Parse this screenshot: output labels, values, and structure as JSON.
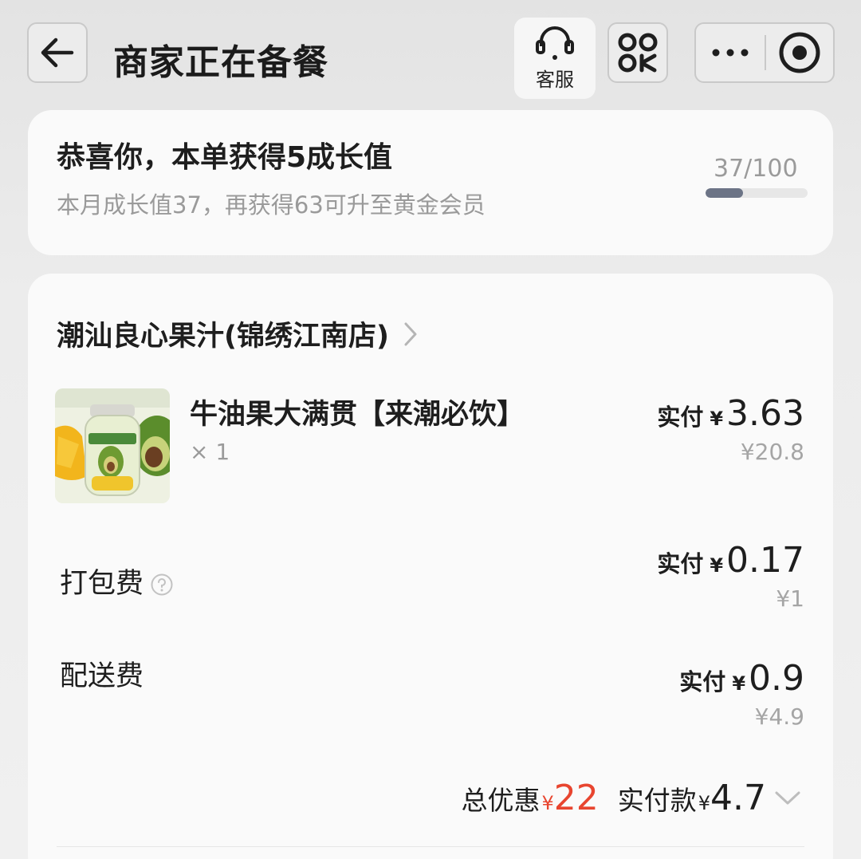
{
  "header": {
    "title": "商家正在备餐",
    "customer_service_label": "客服"
  },
  "growth": {
    "title": "恭喜你，本单获得5成长值",
    "subtitle": "本月成长值37，再获得63可升至黄金会员",
    "progress_text": "37/100",
    "progress_fraction": 0.37
  },
  "order": {
    "shop_name": "潮汕良心果汁(锦绣江南店)",
    "product": {
      "name": "牛油果大满贯【来潮必饮】",
      "qty": "× 1",
      "paid_label": "实付",
      "yen": "¥",
      "paid_amount": "3.63",
      "original_price": "¥20.8"
    },
    "packing_fee": {
      "label": "打包费",
      "paid_label": "实付",
      "yen": "¥",
      "paid_amount": "0.17",
      "original_price": "¥1"
    },
    "delivery_fee": {
      "label": "配送费",
      "paid_label": "实付",
      "yen": "¥",
      "paid_amount": "0.9",
      "original_price": "¥4.9"
    },
    "total": {
      "discount_label": "总优惠",
      "yen": "¥",
      "discount_amount": "22",
      "pay_label": "实付款",
      "pay_amount": "4.7"
    }
  },
  "colors": {
    "accent_red": "#e8452f",
    "progress_fill": "#6c7486"
  }
}
